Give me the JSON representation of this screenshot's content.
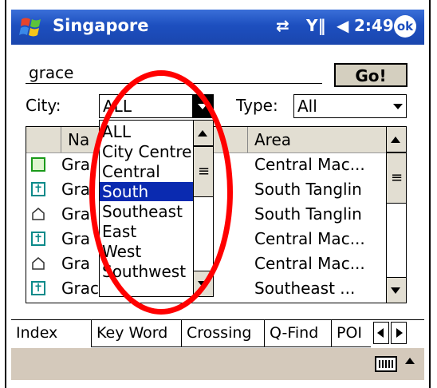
{
  "status_bar": {
    "app_title": "Singapore",
    "time": "2:49",
    "ok_label": "ok"
  },
  "search": {
    "value": "grace",
    "go_label": "Go!"
  },
  "filters": {
    "city_label": "City:",
    "city_value": "ALL",
    "type_label": "Type:",
    "type_value": "All"
  },
  "table": {
    "headers": [
      "Na",
      "Area"
    ],
    "rows": [
      {
        "icon": "building-icon",
        "name": "Gra",
        "area": "Central Mac..."
      },
      {
        "icon": "church-icon",
        "name": "Gra",
        "area": "South Tanglin"
      },
      {
        "icon": "house-icon",
        "name": "Gra",
        "area": "South Tanglin"
      },
      {
        "icon": "church-icon",
        "name": "Gra",
        "area": "Central Mac..."
      },
      {
        "icon": "house-icon",
        "name": "Gra",
        "area": "Central Mac..."
      },
      {
        "icon": "church-icon",
        "name": "Grace Bible",
        "area": "Southeast ..."
      }
    ]
  },
  "city_dropdown": {
    "options": [
      "ALL",
      "City Centre",
      "Central",
      "South",
      "Southeast",
      "East",
      "West",
      "Southwest"
    ],
    "selected": "South"
  },
  "tabs": [
    "Index",
    "Key Word",
    "Crossing",
    "Q-Find",
    "POI"
  ],
  "colors": {
    "titlebar": "#1d4fbf",
    "selection": "#0a2ab0",
    "annotation": "#ff0000",
    "toolbar": "#d4c9bb"
  }
}
